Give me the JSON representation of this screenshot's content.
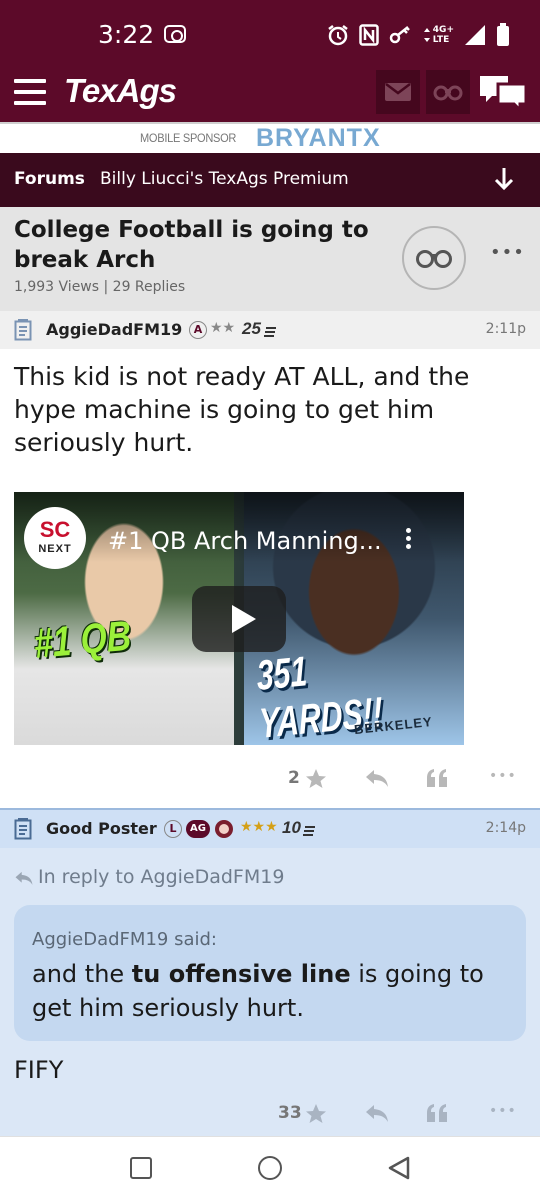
{
  "status_bar": {
    "time": "3:22",
    "network_top": "4G+",
    "network_bottom": "LTE"
  },
  "header": {
    "brand": "TexAgs"
  },
  "sponsor": {
    "label": "MOBILE SPONSOR",
    "brand": "BRYANTX"
  },
  "forum_nav": {
    "forums": "Forums",
    "board": "Billy Liucci's TexAgs Premium"
  },
  "thread": {
    "title": "College Football is going to break Arch",
    "meta": "1,993 Views | 29 Replies"
  },
  "post1": {
    "author": "AggieDadFM19",
    "badge": "A",
    "stars": "★★",
    "rank": "25",
    "time": "2:11p",
    "body": "This kid is not ready AT ALL, and the hype machine is going to get him seriously hurt.",
    "video": {
      "logo_top": "SC",
      "logo_bottom": "NEXT",
      "title": "#1 QB Arch Manning...",
      "overlay_left": "#1 QB",
      "overlay_right": "351 YARDS!!",
      "jersey": "BERKELEY"
    },
    "likes": "2"
  },
  "post2": {
    "author": "Good Poster",
    "badge_l": "L",
    "badge_ag": "AG",
    "stars": "★★★",
    "rank": "10",
    "time": "2:14p",
    "reply_to": "In reply to AggieDadFM19",
    "quote_author": "AggieDadFM19 said:",
    "quote_before": "and the ",
    "quote_bold": "tu offensive line",
    "quote_after": " is going to get him seriously hurt.",
    "body": "FIFY",
    "likes": "33"
  },
  "colors": {
    "maroon": "#5c0a29",
    "dark_maroon": "#3a0a1d",
    "quote_blue": "#c4d8f0",
    "post_blue": "#dbe7f6",
    "star_gold": "#d4a017"
  }
}
